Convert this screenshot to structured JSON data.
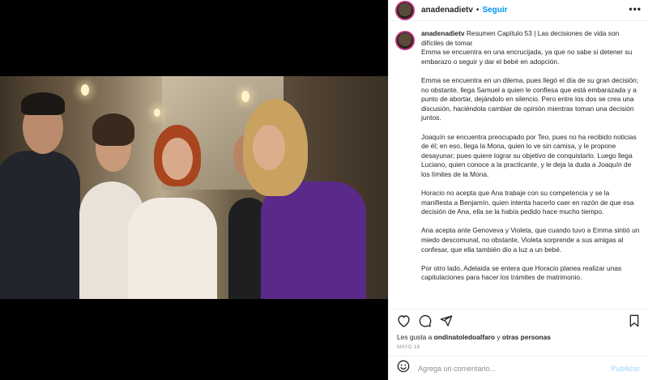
{
  "header": {
    "username": "anadenadietv",
    "separator": "•",
    "follow_label": "Seguir",
    "more_glyph": "•••"
  },
  "caption": {
    "username": "anadenadietv",
    "paragraphs": [
      "Resumen Capítulo 53 | Las decisiones de vida son difíciles de tomar\nEmma se encuentra en una encrucijada, ya que no sabe si detener su embarazo o seguir y dar el bebé en adopción.",
      "Emma se encuentra en un dilema, pues llegó el día de su gran decisión; no obstante, llega Samuel a quien le confiesa que está embarazada y a punto de abortar, dejándolo en silencio. Pero entre los dos se crea una discusión, haciéndola cambiar de opinión mientras toman una decisión juntos.",
      "Joaquín se encuentra preocupado por Teo, pues no ha recibido noticias de él; en eso, llega la Mona, quien lo ve sin camisa, y le propone desayunar; pues quiere lograr su objetivo de conquistarlo. Luego llega Luciano, quien conoce a la practicante, y le deja la duda a Joaquín de los límites de la Mona.",
      "Horacio no acepta que Ana trabaje con su competencia y se la manifiesta a Benjamín, quien intenta hacerlo caer en razón de que esa decisión de Ana, ella se la había pedido hace mucho tiempo.",
      "Ana acepta ante Genoveva y Violeta, que cuando tuvo a Emma sintió un miedo descomunal, no obstante, Violeta sorprende a sus amigas al confesar, que ella también dio a luz a un bebé.",
      "Por otro lado, Adelaida se entera que Horacio planea realizar unas capitulaciones para hacer los trámites de matrimonio."
    ]
  },
  "actions": {
    "like_icon": "heart-icon",
    "comment_icon": "comment-icon",
    "share_icon": "share-icon",
    "save_icon": "bookmark-icon"
  },
  "likes": {
    "prefix": "Les gusta a ",
    "user": "ondinatoledoalfaro",
    "middle": " y ",
    "others": "otras personas"
  },
  "date": "MAYO 18",
  "comment": {
    "placeholder": "Agrega un comentario...",
    "publish_label": "Publicar",
    "emoji_icon": "emoji-icon"
  },
  "colors": {
    "link": "#0095f6",
    "publish_disabled": "#b2dffc",
    "ring": "#c13584"
  }
}
